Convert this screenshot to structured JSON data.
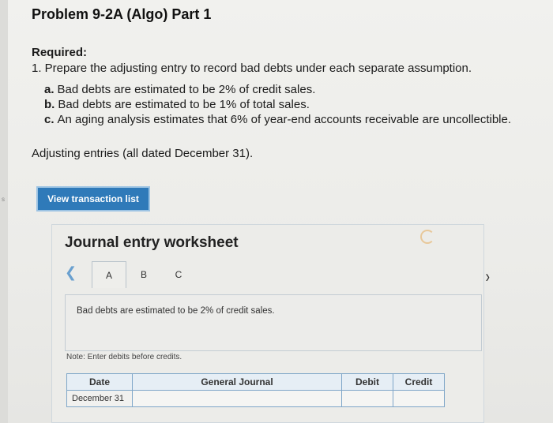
{
  "header": {
    "title": "Problem 9-2A (Algo) Part 1"
  },
  "required": {
    "label": "Required:",
    "instruction": "1. Prepare the adjusting entry to record bad debts under each separate assumption.",
    "options": [
      {
        "letter": "a.",
        "text": "Bad debts are estimated to be 2% of credit sales."
      },
      {
        "letter": "b.",
        "text": "Bad debts are estimated to be 1% of total sales."
      },
      {
        "letter": "c.",
        "text": "An aging analysis estimates that 6% of year-end accounts receivable are uncollectible."
      }
    ]
  },
  "adjusting_note": "Adjusting entries (all dated December 31).",
  "view_button": {
    "label": "View transaction list"
  },
  "worksheet": {
    "title": "Journal entry worksheet",
    "tabs": [
      "A",
      "B",
      "C"
    ],
    "active_tab": "A",
    "description": "Bad debts are estimated to be 2% of credit sales.",
    "note": "Note: Enter debits before credits.",
    "columns": {
      "date": "Date",
      "journal": "General Journal",
      "debit": "Debit",
      "credit": "Credit"
    },
    "rows": [
      {
        "date": "December 31",
        "journal": "",
        "debit": "",
        "credit": ""
      }
    ]
  },
  "margin_mark": "s"
}
